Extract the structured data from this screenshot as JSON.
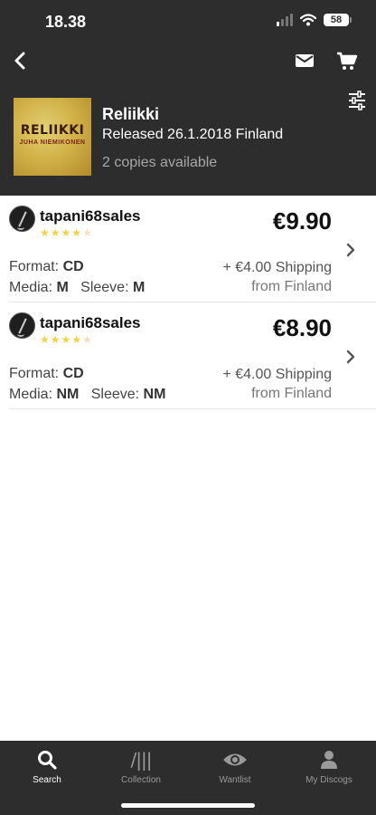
{
  "status_bar": {
    "time": "18.38",
    "battery": "58"
  },
  "header": {
    "back_icon": "chevron-left-icon",
    "mail_icon": "envelope-icon",
    "cart_icon": "cart-icon",
    "filter_icon": "sliders-icon"
  },
  "release": {
    "cover_title": "RELIIKKI",
    "cover_artist": "JUHA NIEMIKONEN",
    "title": "Reliikki",
    "released": "Released 26.1.2018 Finland",
    "copies": "2 copies available"
  },
  "listings": [
    {
      "seller": "tapani68sales",
      "rating_stars": 4.5,
      "price": "€9.90",
      "format_label": "Format:",
      "format": "CD",
      "media_label": "Media:",
      "media": "M",
      "sleeve_label": "Sleeve:",
      "sleeve": "M",
      "shipping": "+ €4.00 Shipping",
      "ships_from": "from Finland"
    },
    {
      "seller": "tapani68sales",
      "rating_stars": 4.5,
      "price": "€8.90",
      "format_label": "Format:",
      "format": "CD",
      "media_label": "Media:",
      "media": "NM",
      "sleeve_label": "Sleeve:",
      "sleeve": "NM",
      "shipping": "+ €4.00 Shipping",
      "ships_from": "from Finland"
    }
  ],
  "tabbar": {
    "tabs": [
      {
        "label": "Search",
        "icon": "search-icon",
        "active": true
      },
      {
        "label": "Collection",
        "icon": "collection-icon",
        "active": false
      },
      {
        "label": "Wantlist",
        "icon": "eye-icon",
        "active": false
      },
      {
        "label": "My Discogs",
        "icon": "user-icon",
        "active": false
      }
    ]
  },
  "colors": {
    "header_bg": "#2d2d2d",
    "star": "#f2d14c",
    "background": "#ffffff"
  }
}
